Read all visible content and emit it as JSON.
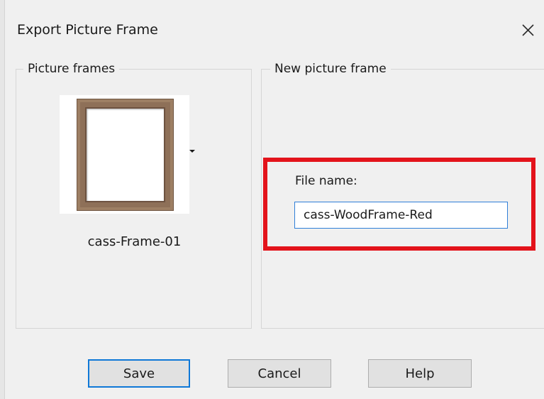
{
  "window": {
    "title": "Export Picture Frame",
    "close_icon": "close-icon"
  },
  "picture_frames": {
    "legend": "Picture frames",
    "selected_frame_name": "cass-Frame-01",
    "dropdown_icon": "caret-down-icon"
  },
  "new_frame": {
    "legend": "New picture frame",
    "file_name_label": "File name:",
    "file_name_value": "cass-WoodFrame-Red",
    "highlight_color": "#e3131b"
  },
  "buttons": {
    "save": "Save",
    "cancel": "Cancel",
    "help": "Help"
  }
}
